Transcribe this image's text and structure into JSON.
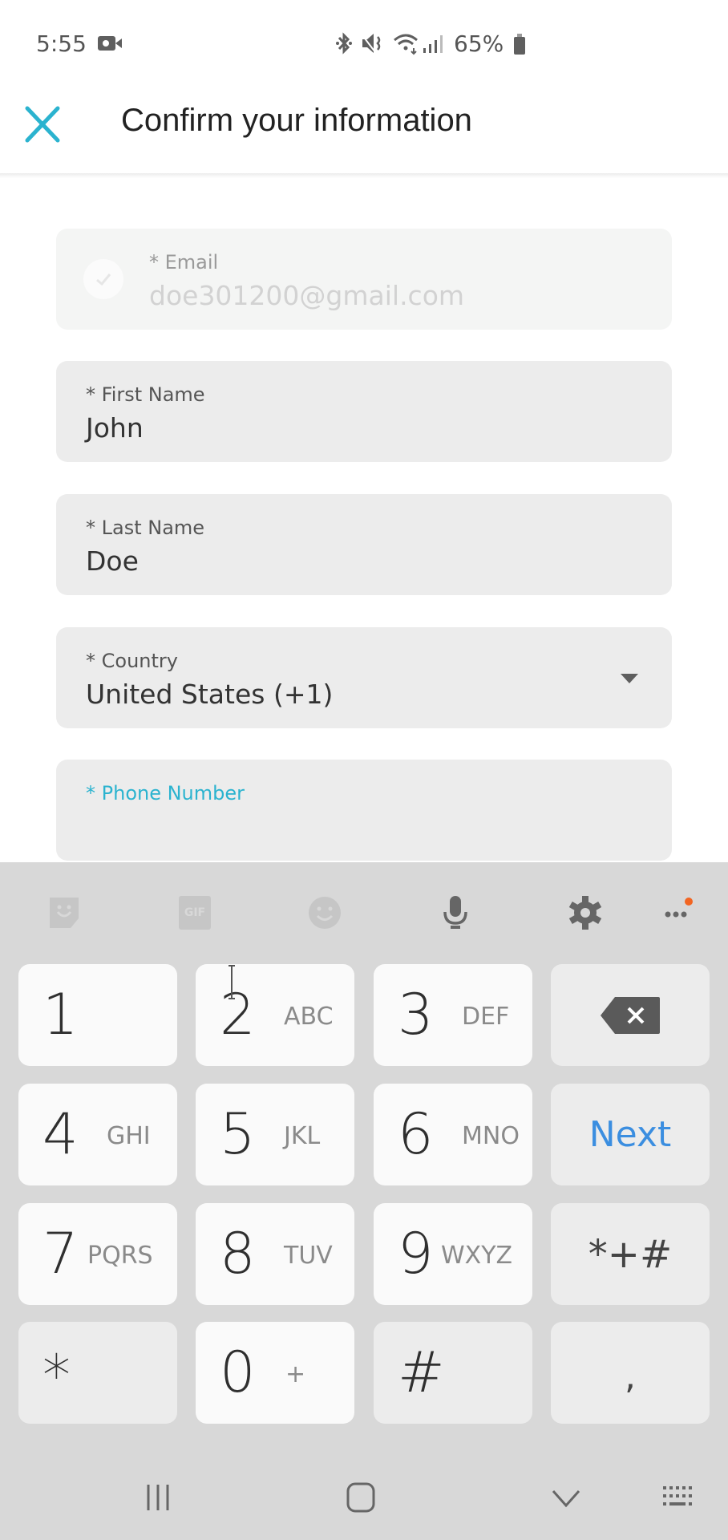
{
  "status_bar": {
    "time": "5:55",
    "battery": "65%",
    "icons": [
      "video-camera-icon",
      "bluetooth-icon",
      "mute-icon",
      "wifi-icon",
      "signal-icon",
      "battery-icon"
    ]
  },
  "header": {
    "title": "Confirm your information",
    "close_icon": "close-icon"
  },
  "form": {
    "email": {
      "label": "* Email",
      "value": "doe301200@gmail.com",
      "verified": true,
      "disabled": true
    },
    "first_name": {
      "label": "* First Name",
      "value": "John"
    },
    "last_name": {
      "label": "* Last Name",
      "value": "Doe"
    },
    "country": {
      "label": "* Country",
      "value": "United States (+1)"
    },
    "phone": {
      "label": "* Phone Number",
      "value": ""
    }
  },
  "keyboard": {
    "toolbar": [
      "sticker-icon",
      "gif-icon",
      "emoji-icon",
      "microphone-icon",
      "settings-icon",
      "more-icon"
    ],
    "gif_label": "GIF",
    "keys": [
      {
        "num": "1",
        "letters": ""
      },
      {
        "num": "2",
        "letters": "ABC"
      },
      {
        "num": "3",
        "letters": "DEF"
      },
      {
        "num": "4",
        "letters": "GHI"
      },
      {
        "num": "5",
        "letters": "JKL"
      },
      {
        "num": "6",
        "letters": "MNO"
      },
      {
        "num": "7",
        "letters": "PQRS"
      },
      {
        "num": "8",
        "letters": "TUV"
      },
      {
        "num": "9",
        "letters": "WXYZ"
      },
      {
        "num": "*",
        "letters": ""
      },
      {
        "num": "0",
        "letters": "+"
      },
      {
        "num": "#",
        "letters": ""
      }
    ],
    "next_label": "Next",
    "symbols_label": "*+#",
    "comma_label": ",",
    "accent_color": "#3b8ee0"
  },
  "colors": {
    "brand": "#2bb3cf",
    "field_bg": "#ececec",
    "keyboard_bg": "#d8d8d8"
  }
}
